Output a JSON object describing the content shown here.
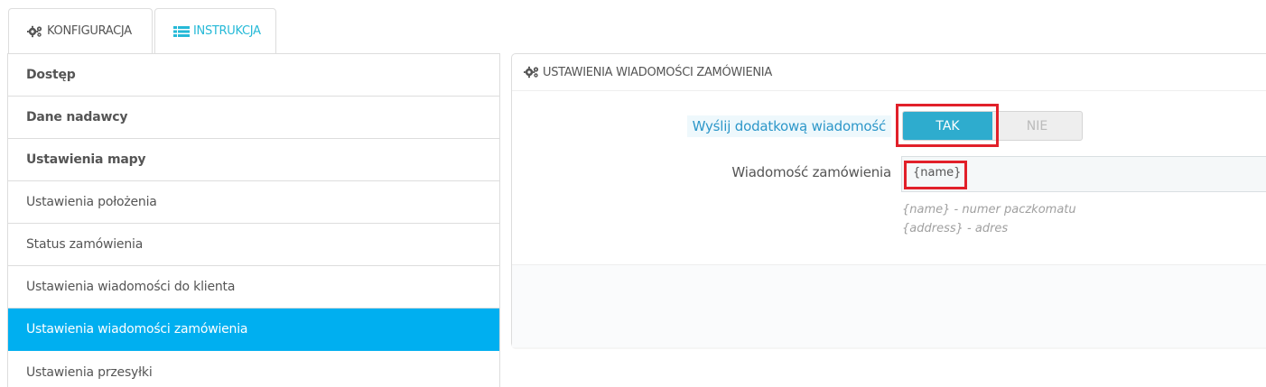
{
  "tabs": [
    {
      "label": "Konfiguracja",
      "icon": "gears-icon",
      "active": true
    },
    {
      "label": "Instrukcja",
      "icon": "list-icon",
      "active": false
    }
  ],
  "sidebar": {
    "items": [
      {
        "label": "Dostęp"
      },
      {
        "label": "Dane nadawcy"
      },
      {
        "label": "Ustawienia mapy"
      },
      {
        "label": "Ustawienia położenia"
      },
      {
        "label": "Status zamówienia"
      },
      {
        "label": "Ustawienia wiadomości do klienta"
      },
      {
        "label": "Ustawienia wiadomości zamówienia"
      },
      {
        "label": "Ustawienia przesyłki"
      }
    ]
  },
  "panel": {
    "title": "Ustawienia wiadomości zamówienia",
    "send_label": "Wyślij dodatkową wiadomość",
    "switch": {
      "on_label": "TAK",
      "off_label": "NIE",
      "selected": "TAK"
    },
    "message_label": "Wiadomość zamówienia",
    "message_value": "{name}",
    "help": [
      "{name} - numer paczkomatu",
      "{address} - adres"
    ]
  },
  "colors": {
    "accent": "#00aff0",
    "switch_on": "#2eacce",
    "highlight": "#e1202a",
    "link": "#25b9d7"
  }
}
